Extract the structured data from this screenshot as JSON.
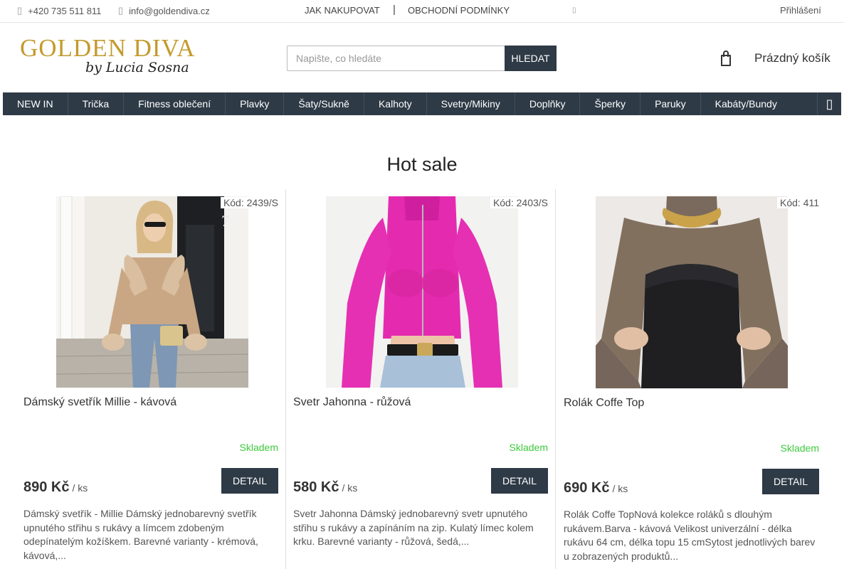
{
  "topbar": {
    "phone": "+420 735 511 811",
    "email": "info@goldendiva.cz",
    "links": [
      "JAK NAKUPOVAT",
      "OBCHODNÍ PODMÍNKY"
    ],
    "login": "Přihlášení"
  },
  "logo": {
    "line1": "GOLDEN DIVA",
    "line2": "by Lucia Sosna"
  },
  "search": {
    "placeholder": "Napište, co hledáte",
    "button": "HLEDAT"
  },
  "cart": {
    "label": "Prázdný košík"
  },
  "nav": {
    "items": [
      "NEW IN",
      "Trička",
      "Fitness oblečení",
      "Plavky",
      "Šaty/Sukně",
      "Kalhoty",
      "Svetry/Mikiny",
      "Doplňky",
      "Šperky",
      "Paruky",
      "Kabáty/Bundy"
    ]
  },
  "section": {
    "title": "Hot sale"
  },
  "products": [
    {
      "code": "Kód: 2439/S",
      "name": "Dámský svetřík Millie - kávová",
      "stock": "Skladem",
      "price": "890 Kč",
      "unit": "/ ks",
      "detail": "DETAIL",
      "description": "Dámský svetřík - Millie  Dámský jednobarevný svetřík upnutého střihu s rukávy a límcem zdobeným odepínatelým kožíškem.  Barevné varianty - krémová, kávová,...",
      "image_number": "7"
    },
    {
      "code": "Kód: 2403/S",
      "name": "Svetr Jahonna - růžová",
      "stock": "Skladem",
      "price": "580 Kč",
      "unit": "/ ks",
      "detail": "DETAIL",
      "description": "Svetr Jahonna  Dámský jednobarevný svetr upnutého střihu s rukávy a zapínáním na zip. Kulatý límec kolem krku. Barevné varianty - růžová, šedá,..."
    },
    {
      "code": "Kód: 411",
      "name": "Rolák Coffe Top",
      "stock": "Skladem",
      "price": "690 Kč",
      "unit": "/ ks",
      "detail": "DETAIL",
      "description": "Rolák Coffe TopNová kolekce roláků s dlouhým rukávem.Barva - kávová Velikost univerzální - délka rukávu 64 cm, délka topu 15 cmSytost jednotlivých barev u zobrazených produktů..."
    }
  ],
  "colors": {
    "dark": "#2e3a46",
    "gold": "#c49a2c",
    "stock_green": "#3ec93e"
  }
}
